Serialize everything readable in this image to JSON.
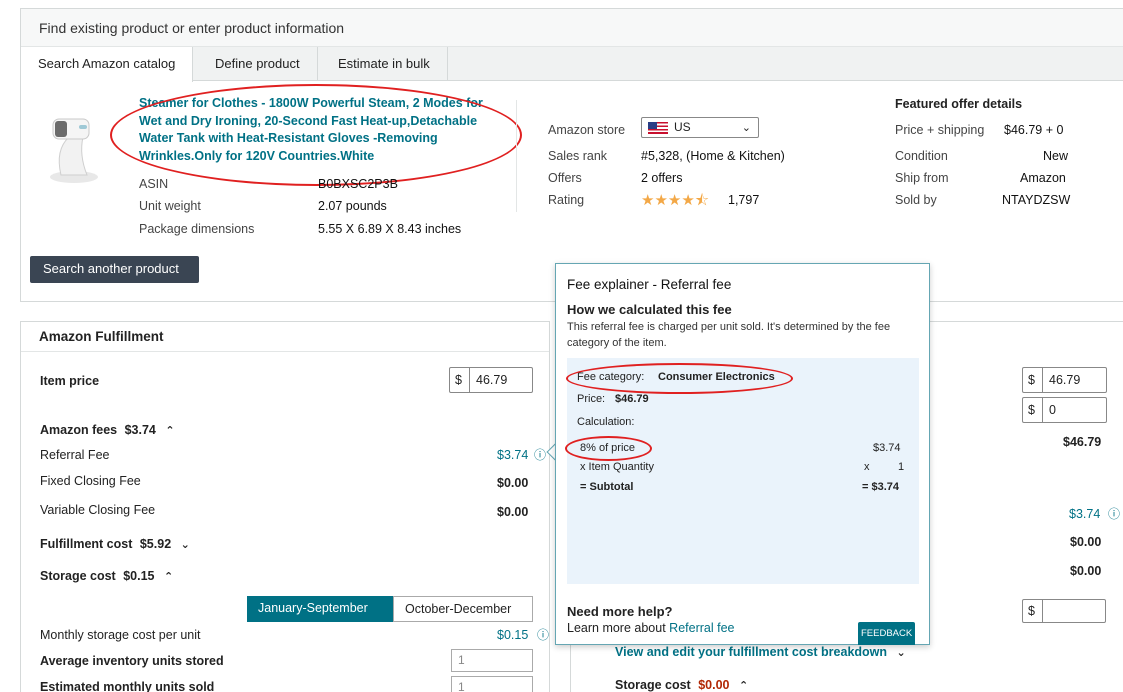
{
  "header": {
    "title": "Find existing product or enter product information"
  },
  "tabs": [
    {
      "label": "Search Amazon catalog",
      "active": true
    },
    {
      "label": "Define product",
      "active": false
    },
    {
      "label": "Estimate in bulk",
      "active": false
    }
  ],
  "product": {
    "title": "Steamer for Clothes - 1800W Powerful Steam, 2 Modes for Wet and Dry Ironing, 20-Second Fast Heat-up,Detachable Water Tank with Heat-Resistant Gloves -Removing Wrinkles.Only for 120V Countries.White",
    "asin_label": "ASIN",
    "asin_value": "B0BXSC2P3B",
    "weight_label": "Unit weight",
    "weight_value": "2.07 pounds",
    "dims_label": "Package dimensions",
    "dims_value": "5.55 X 6.89 X 8.43 inches"
  },
  "store": {
    "store_label": "Amazon store",
    "store_value": "US",
    "rank_label": "Sales rank",
    "rank_value": "#5,328, (Home & Kitchen)",
    "offers_label": "Offers",
    "offers_value": "2 offers",
    "rating_label": "Rating",
    "rating_count": "1,797",
    "rating_stars": 4.5
  },
  "featured": {
    "heading": "Featured offer details",
    "price_label": "Price + shipping",
    "price_value": "$46.79 + 0",
    "condition_label": "Condition",
    "condition_value": "New",
    "ship_label": "Ship from",
    "ship_value": "Amazon",
    "sold_label": "Sold by",
    "sold_value": "NTAYDZSW"
  },
  "search_another": "Search another product",
  "fulfillment": {
    "heading": "Amazon Fulfillment",
    "item_price_label": "Item price",
    "currency": "$",
    "item_price_value": "46.79",
    "fees_label": "Amazon fees",
    "fees_value": "$3.74",
    "referral_label": "Referral Fee",
    "referral_value": "$3.74",
    "fixed_label": "Fixed Closing Fee",
    "fixed_value": "$0.00",
    "variable_label": "Variable Closing Fee",
    "variable_value": "$0.00",
    "fulfillment_cost_label": "Fulfillment cost",
    "fulfillment_cost_value": "$5.92",
    "storage_label": "Storage cost",
    "storage_value": "$0.15",
    "season_1": "January-September",
    "season_2": "October-December",
    "monthly_label": "Monthly storage cost per unit",
    "monthly_value": "$0.15",
    "avg_inv_label": "Average inventory units stored",
    "avg_inv_value": "1",
    "est_units_label": "Estimated monthly units sold",
    "est_units_value": "1"
  },
  "right_panel": {
    "price_value": "46.79",
    "ship_value": "0",
    "total": "$46.79",
    "referral_value": "$3.74",
    "v1": "$0.00",
    "v2": "$0.00",
    "view_edit": "View and edit your fulfillment cost breakdown",
    "storage_label": "Storage cost",
    "storage_value": "$0.00"
  },
  "popover": {
    "title": "Fee explainer - Referral fee",
    "subtitle": "How we calculated this fee",
    "desc": "This referral fee is charged per unit sold. It's determined by the fee category of the item.",
    "category_label": "Fee category:",
    "category_value": "Consumer Electronics",
    "price_label": "Price:",
    "price_value": "$46.79",
    "calc_label": "Calculation:",
    "pct_label": "8% of price",
    "pct_value": "$3.74",
    "qty_label": "x Item Quantity",
    "qty_op": "x",
    "qty_value": "1",
    "subtotal_label": "= Subtotal",
    "subtotal_value": "= $3.74",
    "help_title": "Need more help?",
    "help_text": "Learn more about",
    "help_link": "Referral fee",
    "feedback": "FEEDBACK"
  }
}
